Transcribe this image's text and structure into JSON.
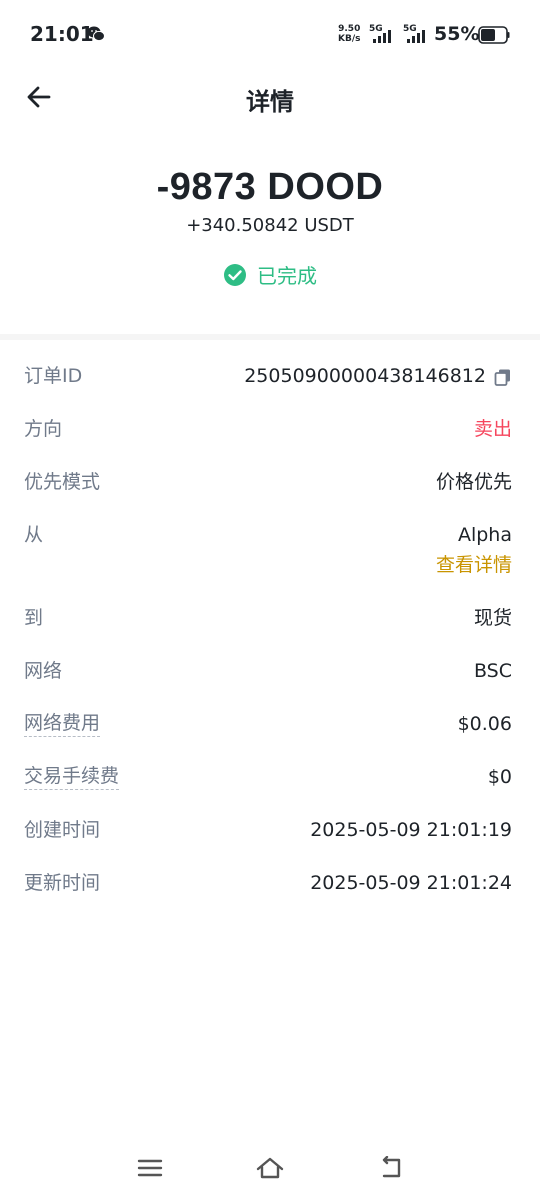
{
  "status_bar": {
    "time": "21:01",
    "speed_value": "9.50",
    "speed_unit": "KB/s",
    "network_1": "5G",
    "network_2": "5G",
    "battery": "55%",
    "icons": [
      "wechat-icon",
      "signal-icon",
      "battery-icon"
    ]
  },
  "header": {
    "title": "详情",
    "back_icon": "arrow-left-icon"
  },
  "summary": {
    "primary_amount": "-9873 DOOD",
    "secondary_amount": "+340.50842 USDT",
    "status_text": "已完成",
    "status_icon": "check-circle-icon"
  },
  "details": {
    "order_id": {
      "label": "订单ID",
      "value": "25050900000438146812"
    },
    "direction": {
      "label": "方向",
      "value": "卖出"
    },
    "priority_mode": {
      "label": "优先模式",
      "value": "价格优先"
    },
    "from": {
      "label": "从",
      "value": "Alpha",
      "link": "查看详情"
    },
    "to": {
      "label": "到",
      "value": "现货"
    },
    "network": {
      "label": "网络",
      "value": "BSC"
    },
    "network_fee": {
      "label": "网络费用",
      "value": "$0.06"
    },
    "trading_fee": {
      "label": "交易手续费",
      "value": "$0"
    },
    "created_time": {
      "label": "创建时间",
      "value": "2025-05-09 21:01:19"
    },
    "updated_time": {
      "label": "更新时间",
      "value": "2025-05-09 21:01:24"
    }
  },
  "colors": {
    "text_primary": "#1e2329",
    "text_secondary": "#707a8a",
    "success": "#2ebd85",
    "sell": "#f6465d",
    "link": "#c99400"
  },
  "nav_bar": {
    "icons": [
      "menu-icon",
      "home-icon",
      "back-icon"
    ]
  }
}
